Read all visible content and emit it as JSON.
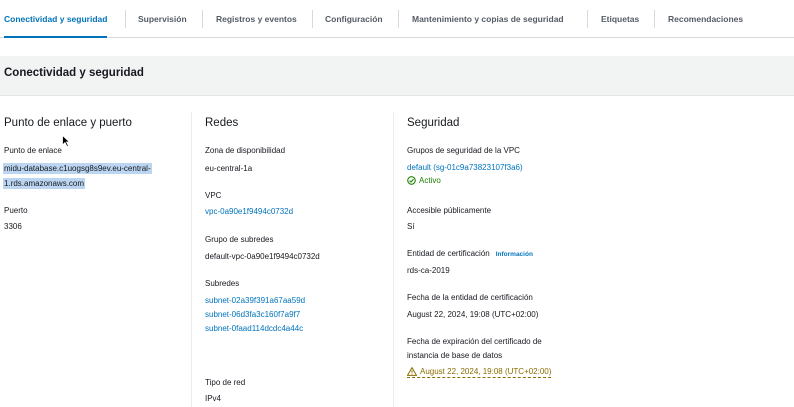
{
  "tabs": [
    {
      "label": "Conectividad y seguridad",
      "active": true
    },
    {
      "label": "Supervisión"
    },
    {
      "label": "Registros y eventos"
    },
    {
      "label": "Configuración"
    },
    {
      "label": "Mantenimiento y copias de seguridad"
    },
    {
      "label": "Etiquetas"
    },
    {
      "label": "Recomendaciones"
    }
  ],
  "section": {
    "title": "Conectividad y seguridad"
  },
  "endpoint": {
    "title": "Punto de enlace y puerto",
    "endpoint_label": "Punto de enlace",
    "endpoint_line1": "midu-database.c1uogsg8s9ev.eu-central-",
    "endpoint_line2": "1.rds.amazonaws.com",
    "port_label": "Puerto",
    "port_value": "3306"
  },
  "network": {
    "title": "Redes",
    "az_label": "Zona de disponibilidad",
    "az_value": "eu-central-1a",
    "vpc_label": "VPC",
    "vpc_value": "vpc-0a90e1f9494c0732d",
    "subnet_group_label": "Grupo de subredes",
    "subnet_group_value": "default-vpc-0a90e1f9494c0732d",
    "subnets_label": "Subredes",
    "subnets": [
      "subnet-02a39f391a67aa59d",
      "subnet-06d3fa3c160f7a9f7",
      "subnet-0faad114dcdc4a44c"
    ],
    "network_type_label": "Tipo de red",
    "network_type_value": "IPv4"
  },
  "security": {
    "title": "Seguridad",
    "sg_label": "Grupos de seguridad de la VPC",
    "sg_value": "default (sg-01c9a73823107f3a6)",
    "sg_status": "Activo",
    "public_label": "Accesible públicamente",
    "public_value": "Sí",
    "ca_label": "Entidad de certificación",
    "ca_info": "Información",
    "ca_value": "rds-ca-2019",
    "ca_date_label": "Fecha de la entidad de certificación",
    "ca_date_value": "August 22, 2024, 19:08 (UTC+02:00)",
    "expiry_label_line1": "Fecha de expiración del certificado de",
    "expiry_label_line2": "instancia de base de datos",
    "expiry_value": "August 22, 2024, 19:08 (UTC+02:00)"
  },
  "colors": {
    "link": "#0073bb",
    "success": "#1d8102",
    "warning": "#8a6d00",
    "selection": "#bcd6f2"
  }
}
